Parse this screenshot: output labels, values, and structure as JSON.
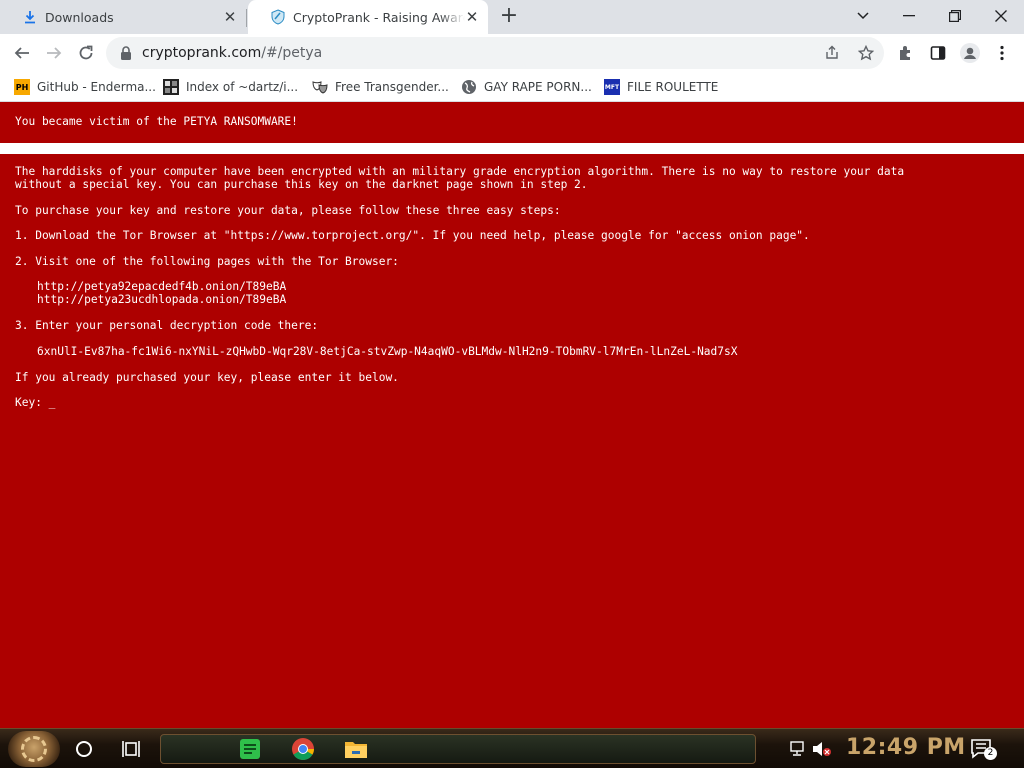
{
  "tabs": [
    {
      "title": "Downloads",
      "icon": "download-icon"
    },
    {
      "title": "CryptoPrank - Raising Awareness",
      "icon": "cryptoprank-icon"
    }
  ],
  "address_bar": {
    "host": "cryptoprank.com",
    "path": "/#/petya"
  },
  "bookmarks": [
    {
      "label": "GitHub - Enderma...",
      "icon": "ph-icon",
      "icon_text": "PH"
    },
    {
      "label": "Index of ~dartz/i...",
      "icon": "grid-icon",
      "icon_text": ""
    },
    {
      "label": "Free Transgender...",
      "icon": "masks-icon",
      "icon_text": ""
    },
    {
      "label": "GAY RAPE PORN...",
      "icon": "globe-icon",
      "icon_text": ""
    },
    {
      "label": "FILE ROULETTE",
      "icon": "roulette-icon",
      "icon_text": "MFT"
    }
  ],
  "page": {
    "header": "You became victim of the PETYA RANSOMWARE!",
    "para1_line1": "The harddisks of your computer have been encrypted with an military grade encryption algorithm. There is no way to restore your data",
    "para1_line2": "without a special key. You can purchase this key on the darknet page shown in step 2.",
    "intro": "To purchase your key and restore your data, please follow these three easy steps:",
    "step1": "1. Download the Tor Browser at \"https://www.torproject.org/\". If you need help, please google for \"access onion page\".",
    "step2": "2. Visit one of the following pages with the Tor Browser:",
    "url1": "http://petya92epacdedf4b.onion/T89eBA",
    "url2": "http://petya23ucdhlopada.onion/T89eBA",
    "step3": "3. Enter your personal decryption code there:",
    "code": "6xnUlI-Ev87ha-fc1Wi6-nxYNiL-zQHwbD-Wqr28V-8etjCa-stvZwp-N4aqWO-vBLMdw-NlH2n9-TObmRV-l7MrEn-lLnZeL-Nad7sX",
    "already": "If you already purchased your key, please enter it below.",
    "key_prompt": "Key: _"
  },
  "taskbar": {
    "clock": "12:49 PM",
    "notifications": "2"
  },
  "colors": {
    "page_bg": "#ad0000",
    "text": "#ffffff",
    "clock": "#c9a46a"
  }
}
